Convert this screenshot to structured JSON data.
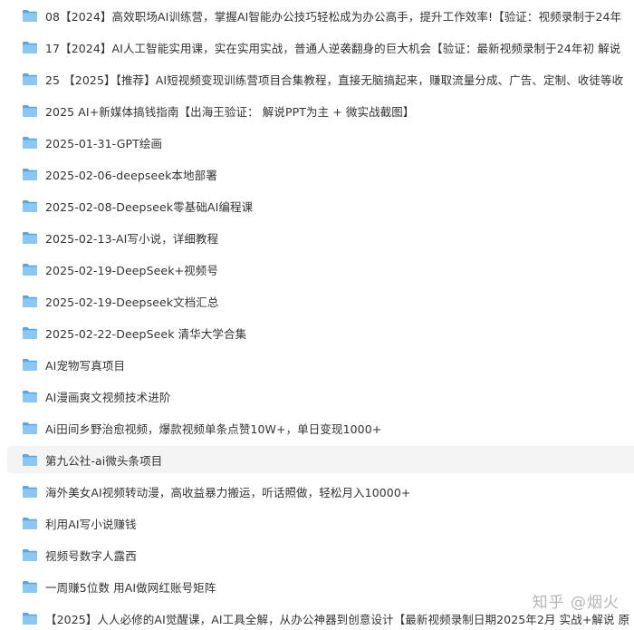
{
  "colors": {
    "folder_back": "#5aa5e3",
    "folder_front": "#8cc6f3",
    "text": "#333333",
    "selected_bg": "#f4f4f5"
  },
  "files": [
    {
      "name": "08【2024】高效职场AI训练营，掌握AI智能办公技巧轻松成为办公高手，提升工作效率!【验证：视频录制于24年",
      "icon": "folder-icon"
    },
    {
      "name": "17【2024】AI人工智能实用课，实在实用实战，普通人逆袭翻身的巨大机会【验证：最新视频录制于24年初 解说",
      "icon": "folder-icon"
    },
    {
      "name": "25 【2025】【推荐】AI短视频变现训练营项目合集教程，直接无脑搞起来，赚取流量分成、广告、定制、收徒等收",
      "icon": "folder-icon"
    },
    {
      "name": "2025 AI+新媒体搞钱指南【出海王验证： 解说PPT为主 + 微实战截图】",
      "icon": "folder-icon"
    },
    {
      "name": "2025-01-31-GPT绘画",
      "icon": "folder-icon"
    },
    {
      "name": "2025-02-06-deepseek本地部署",
      "icon": "folder-icon"
    },
    {
      "name": "2025-02-08-Deepseek零基础AI编程课",
      "icon": "folder-icon"
    },
    {
      "name": "2025-02-13-AI写小说，详细教程",
      "icon": "folder-icon"
    },
    {
      "name": "2025-02-19-DeepSeek+视频号",
      "icon": "folder-icon"
    },
    {
      "name": "2025-02-19-Deepseek文档汇总",
      "icon": "folder-icon"
    },
    {
      "name": "2025-02-22-DeepSeek 清华大学合集",
      "icon": "folder-icon"
    },
    {
      "name": "AI宠物写真项目",
      "icon": "folder-icon"
    },
    {
      "name": "AI漫画爽文视频技术进阶",
      "icon": "folder-icon"
    },
    {
      "name": "Ai田间乡野治愈视频，爆款视频单条点赞10W+，单日变现1000+",
      "icon": "folder-icon"
    },
    {
      "name": "第九公社-ai微头条项目",
      "icon": "folder-icon",
      "selected": true
    },
    {
      "name": "海外美女AI视频转动漫，高收益暴力搬运，听话照做，轻松月入10000+",
      "icon": "folder-icon"
    },
    {
      "name": "利用AI写小说赚钱",
      "icon": "folder-icon"
    },
    {
      "name": "视频号数字人露西",
      "icon": "folder-icon"
    },
    {
      "name": "一周赚5位数 用AI做网红账号矩阵",
      "icon": "folder-icon"
    },
    {
      "name": "【2025】人人必修的AI觉醒课，AI工具全解，从办公神器到创意设计【最新视频录制日期2025年2月 实战+解说 原",
      "icon": "folder-icon"
    }
  ],
  "watermark": "知乎 @烟火"
}
